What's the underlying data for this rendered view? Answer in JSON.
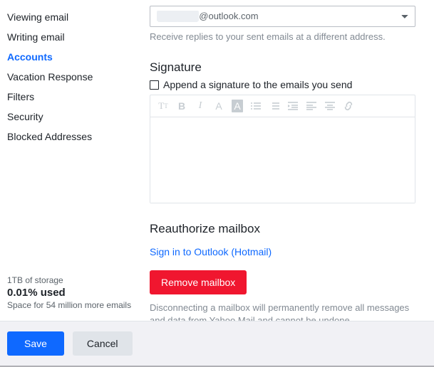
{
  "sidebar": {
    "items": [
      {
        "label": "Viewing email"
      },
      {
        "label": "Writing email"
      },
      {
        "label": "Accounts"
      },
      {
        "label": "Vacation Response"
      },
      {
        "label": "Filters"
      },
      {
        "label": "Security"
      },
      {
        "label": "Blocked Addresses"
      }
    ],
    "activeIndex": 2
  },
  "storage": {
    "total": "1TB of storage",
    "used": "0.01% used",
    "detail": "Space for 54 million more emails"
  },
  "reply": {
    "masked": "██████",
    "domain": "@outlook.com",
    "help": "Receive replies to your sent emails at a different address."
  },
  "signature": {
    "heading": "Signature",
    "checkbox_label": "Append a signature to the emails you send"
  },
  "reauth": {
    "heading": "Reauthorize mailbox",
    "link": "Sign in to Outlook (Hotmail)",
    "remove": "Remove mailbox",
    "disconnect_text": "Disconnecting a mailbox will permanently remove all messages and data from Yahoo Mail and cannot be undone."
  },
  "footer": {
    "save": "Save",
    "cancel": "Cancel"
  },
  "toolbar_icons": [
    "font-size",
    "bold",
    "italic",
    "font-family",
    "highlight",
    "bullet-list",
    "number-list",
    "indent",
    "align-left",
    "align-center",
    "link"
  ]
}
